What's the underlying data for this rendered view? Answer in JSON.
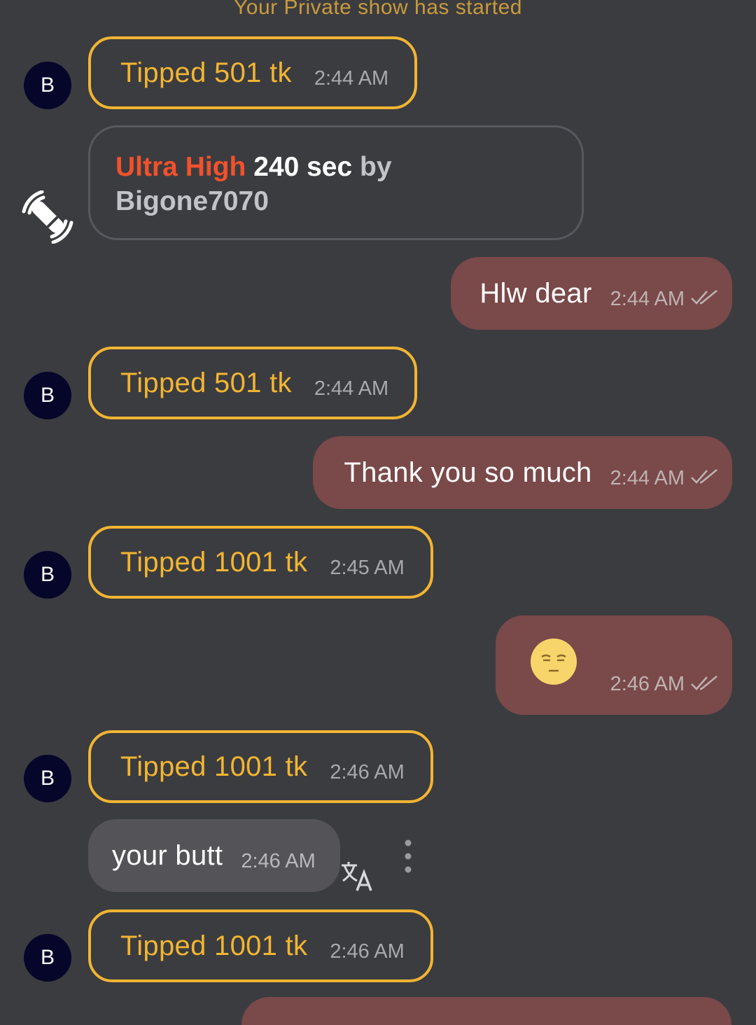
{
  "system_note": "Your Private show has started",
  "avatar_letter": "B",
  "tips": [
    {
      "text": "Tipped 501 tk",
      "time": "2:44 AM"
    },
    {
      "text": "Tipped 501 tk",
      "time": "2:44 AM"
    },
    {
      "text": "Tipped 1001 tk",
      "time": "2:45 AM"
    },
    {
      "text": "Tipped 1001 tk",
      "time": "2:46 AM"
    },
    {
      "text": "Tipped 1001 tk",
      "time": "2:46 AM"
    }
  ],
  "ultra": {
    "level": "Ultra High",
    "duration": "240 sec",
    "by": "by",
    "user": "Bigone7070",
    "icon": "vibration-toy-icon"
  },
  "outgoing": [
    {
      "text": "Hlw dear",
      "time": "2:44 AM",
      "status": "read"
    },
    {
      "text": "Thank you so much",
      "time": "2:44 AM",
      "status": "read"
    },
    {
      "emoji": "expressionless-face",
      "time": "2:46 AM",
      "status": "read"
    }
  ],
  "incoming": [
    {
      "text": "your butt",
      "time": "2:46 AM"
    }
  ],
  "icons": {
    "translate": "translate-icon",
    "more": "more-vertical-icon",
    "read": "double-check-icon"
  },
  "colors": {
    "background": "#3b3c40",
    "tip": "#f2b532",
    "outgoing_bubble": "#7a4949",
    "incoming_bubble": "#545458",
    "ultra_red": "#f2512b",
    "avatar": "#06062a"
  }
}
